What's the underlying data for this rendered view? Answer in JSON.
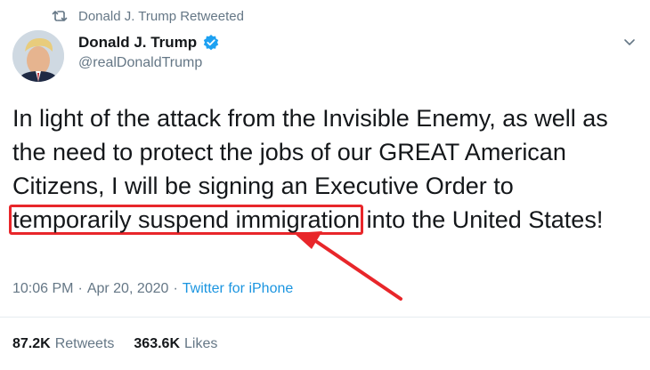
{
  "retweet": {
    "icon": "retweet-icon",
    "label": "Donald J. Trump Retweeted"
  },
  "author": {
    "display_name": "Donald J. Trump",
    "handle": "@realDonaldTrump",
    "verified": true,
    "verified_color": "#1da1f2"
  },
  "tweet": {
    "text_before": "In light of the attack from the Invisible Enemy, as well as the need to protect the jobs of our GREAT American Citizens, I will be signing an Executive Order to ",
    "text_highlighted": "temporarily suspend immigration",
    "text_after": " into the United States!",
    "highlight_color": "#e8262a"
  },
  "meta": {
    "time": "10:06 PM",
    "separator_1": "·",
    "date": "Apr 20, 2020",
    "separator_2": "·",
    "source": "Twitter for iPhone"
  },
  "stats": {
    "retweets_count": "87.2K",
    "retweets_label": "Retweets",
    "likes_count": "363.6K",
    "likes_label": "Likes"
  },
  "colors": {
    "text": "#14171a",
    "muted": "#657786",
    "link": "#1b95e0",
    "divider": "#e6ecf0"
  }
}
